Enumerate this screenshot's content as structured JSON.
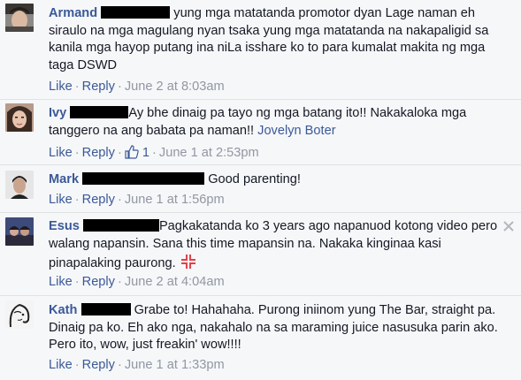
{
  "comments": [
    {
      "name": "Armand",
      "text": "yung mga matatanda promotor dyan Lage naman eh siraulo na mga magulang nyan tsaka yung mga matatanda na nakapaligid sa kanila mga hayop putang ina niLa isshare ko to para kumalat makita ng mga taga DSWD",
      "like_label": "Like",
      "reply_label": "Reply",
      "timestamp": "June 2 at 8:03am"
    },
    {
      "name": "Ivy",
      "text": "Ay bhe dinaig pa tayo ng mga batang ito!! Nakakaloka mga tanggero na ang babata pa naman!!",
      "mention": "Jovelyn Boter",
      "like_label": "Like",
      "reply_label": "Reply",
      "like_count": "1",
      "timestamp": "June 1 at 2:53pm"
    },
    {
      "name": "Mark",
      "text": "Good parenting!",
      "like_label": "Like",
      "reply_label": "Reply",
      "timestamp": "June 1 at 1:56pm"
    },
    {
      "name": "Esus",
      "text": "Pagkakatanda ko 3 years ago napanuod kotong video pero walang napansin. Sana this time mapansin na. Nakaka kinginaa kasi pinapalaking paurong.",
      "like_label": "Like",
      "reply_label": "Reply",
      "timestamp": "June 2 at 4:04am"
    },
    {
      "name": "Kath",
      "text": "Grabe to! Hahahaha. Purong iniinom yung The Bar, straight pa. Dinaig pa ko. Eh ako nga, nakahalo na sa maraming juice nasusuka parin ako. Pero ito, wow, just freakin' wow!!!!",
      "like_label": "Like",
      "reply_label": "Reply",
      "timestamp": "June 1 at 1:33pm"
    }
  ],
  "icons": {
    "emoji": "anger-symbol-icon",
    "close": "close-icon",
    "like_count": "thumbs-up-icon"
  },
  "colors": {
    "link": "#3b5998",
    "meta": "#9197a3",
    "text": "#141823",
    "background": "#f6f7f9"
  }
}
